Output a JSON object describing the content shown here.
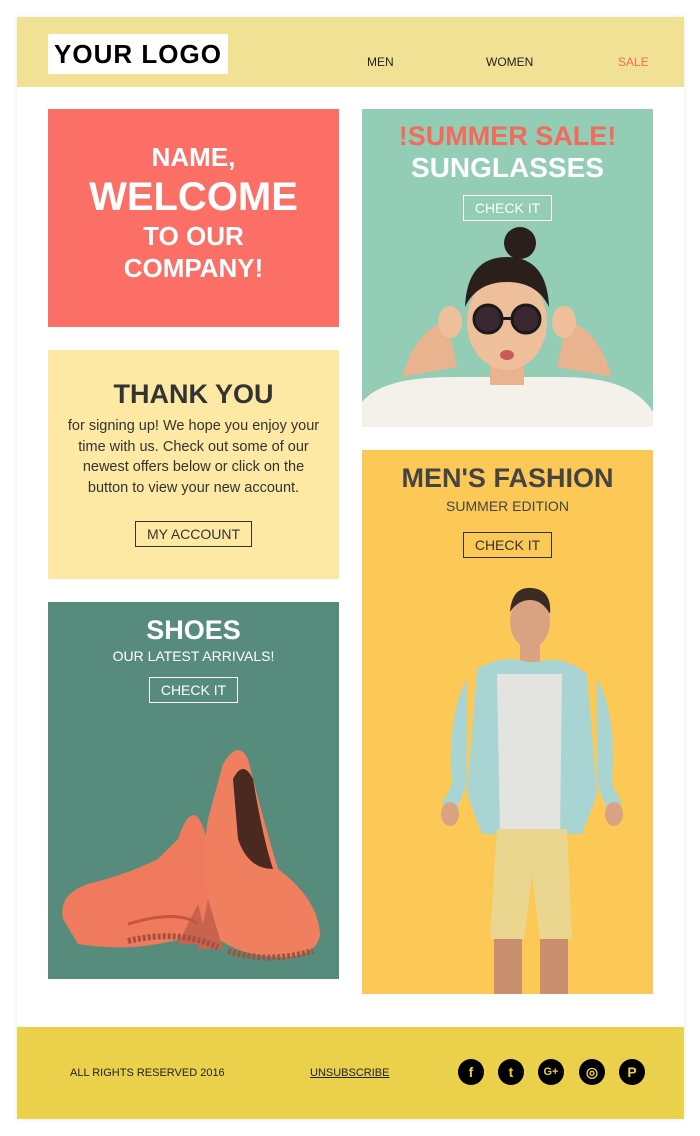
{
  "header": {
    "logo": "YOUR LOGO",
    "nav": [
      "MEN",
      "WOMEN",
      "SALE"
    ]
  },
  "welcome": {
    "line1": "NAME,",
    "line2": "WELCOME",
    "line3": "TO OUR",
    "line4": "COMPANY!"
  },
  "summer": {
    "title": "!SUMMER SALE!",
    "subtitle": "SUNGLASSES",
    "button": "CHECK IT"
  },
  "thanks": {
    "title": "THANK YOU",
    "body": "for signing up! We hope you enjoy your time with us. Check out some of our newest offers below or click on the button to view your new account.",
    "button": "MY ACCOUNT"
  },
  "shoes": {
    "title": "SHOES",
    "subtitle": "OUR LATEST ARRIVALS!",
    "button": "CHECK IT"
  },
  "men": {
    "title": "MEN'S FASHION",
    "subtitle": "SUMMER EDITION",
    "button": "CHECK IT"
  },
  "footer": {
    "rights": "ALL RIGHTS RESERVED 2016",
    "unsubscribe": "UNSUBSCRIBE",
    "social": [
      {
        "icon": "facebook-icon",
        "glyph": "f"
      },
      {
        "icon": "twitter-icon",
        "glyph": "t"
      },
      {
        "icon": "google-plus-icon",
        "glyph": "G+"
      },
      {
        "icon": "instagram-icon",
        "glyph": "◎"
      },
      {
        "icon": "pinterest-icon",
        "glyph": "P"
      }
    ]
  },
  "colors": {
    "header_bg": "#f1e195",
    "welcome_bg": "#fb6f66",
    "summer_bg": "#93cdb5",
    "thanks_bg": "#fde9a3",
    "shoes_bg": "#578c7c",
    "men_bg": "#fdc956",
    "footer_bg": "#ebd04b",
    "sale_accent": "#f26b5b"
  }
}
